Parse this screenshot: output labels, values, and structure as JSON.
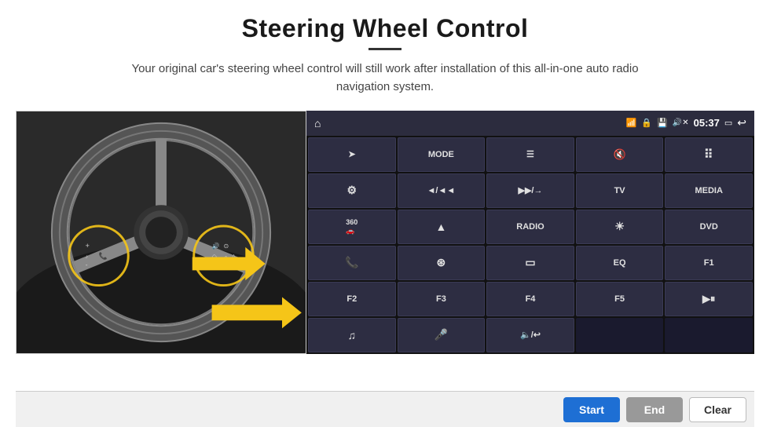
{
  "page": {
    "title": "Steering Wheel Control",
    "subtitle": "Your original car's steering wheel control will still work after installation of this all-in-one auto radio navigation system."
  },
  "status_bar": {
    "time": "05:37",
    "home_icon": "⌂",
    "wifi_icon": "wifi",
    "lock_icon": "🔒",
    "sd_icon": "💾",
    "bt_icon": "🔊",
    "back_icon": "↩",
    "screen_icon": "▭"
  },
  "grid_buttons": [
    {
      "id": "btn-navigate",
      "label": "➤",
      "row": 1,
      "col": 1
    },
    {
      "id": "btn-mode",
      "label": "MODE",
      "row": 1,
      "col": 2
    },
    {
      "id": "btn-list",
      "label": "≡",
      "row": 1,
      "col": 3
    },
    {
      "id": "btn-mute",
      "label": "🔇",
      "row": 1,
      "col": 4
    },
    {
      "id": "btn-apps",
      "label": "⋯",
      "row": 1,
      "col": 5
    },
    {
      "id": "btn-settings",
      "label": "⚙",
      "row": 2,
      "col": 1
    },
    {
      "id": "btn-prev",
      "label": "◄◄",
      "row": 2,
      "col": 2
    },
    {
      "id": "btn-next",
      "label": "▶▶",
      "row": 2,
      "col": 3
    },
    {
      "id": "btn-tv",
      "label": "TV",
      "row": 2,
      "col": 4
    },
    {
      "id": "btn-media",
      "label": "MEDIA",
      "row": 2,
      "col": 5
    },
    {
      "id": "btn-360",
      "label": "360",
      "row": 3,
      "col": 1
    },
    {
      "id": "btn-eject",
      "label": "▲",
      "row": 3,
      "col": 2
    },
    {
      "id": "btn-radio",
      "label": "RADIO",
      "row": 3,
      "col": 3
    },
    {
      "id": "btn-brightness",
      "label": "☀",
      "row": 3,
      "col": 4
    },
    {
      "id": "btn-dvd",
      "label": "DVD",
      "row": 3,
      "col": 5
    },
    {
      "id": "btn-phone",
      "label": "📞",
      "row": 4,
      "col": 1
    },
    {
      "id": "btn-navi",
      "label": "⊛",
      "row": 4,
      "col": 2
    },
    {
      "id": "btn-screen",
      "label": "▭",
      "row": 4,
      "col": 3
    },
    {
      "id": "btn-eq",
      "label": "EQ",
      "row": 4,
      "col": 4
    },
    {
      "id": "btn-f1",
      "label": "F1",
      "row": 4,
      "col": 5
    },
    {
      "id": "btn-f2",
      "label": "F2",
      "row": 5,
      "col": 1
    },
    {
      "id": "btn-f3",
      "label": "F3",
      "row": 5,
      "col": 2
    },
    {
      "id": "btn-f4",
      "label": "F4",
      "row": 5,
      "col": 3
    },
    {
      "id": "btn-f5",
      "label": "F5",
      "row": 5,
      "col": 4
    },
    {
      "id": "btn-playpause",
      "label": "▶⏸",
      "row": 5,
      "col": 5
    },
    {
      "id": "btn-music",
      "label": "♫",
      "row": 6,
      "col": 1
    },
    {
      "id": "btn-mic",
      "label": "🎤",
      "row": 6,
      "col": 2
    },
    {
      "id": "btn-volphone",
      "label": "🔈/↩",
      "row": 6,
      "col": 3
    }
  ],
  "bottom_bar": {
    "start_label": "Start",
    "end_label": "End",
    "clear_label": "Clear"
  }
}
